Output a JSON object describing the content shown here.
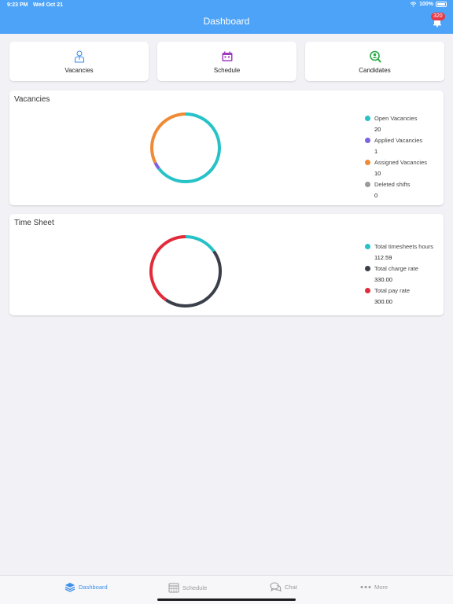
{
  "status_bar": {
    "time": "9:23 PM",
    "date": "Wed Oct 21",
    "battery": "100%"
  },
  "header": {
    "title": "Dashboard",
    "notification_count": "320"
  },
  "tiles": [
    {
      "label": "Vacancies",
      "icon": "person-icon",
      "color": "#3d8fe8"
    },
    {
      "label": "Schedule",
      "icon": "calendar-icon",
      "color": "#9c3dbf"
    },
    {
      "label": "Candidates",
      "icon": "search-person-icon",
      "color": "#27a844"
    }
  ],
  "vacancies_card": {
    "title": "Vacancies",
    "legend": [
      {
        "label": "Open Vacancies",
        "value": "20",
        "color": "#26c2c7"
      },
      {
        "label": "Applied Vacancies",
        "value": "1",
        "color": "#7d63e0"
      },
      {
        "label": "Assigned Vacancies",
        "value": "10",
        "color": "#ef8a35"
      },
      {
        "label": "Deleted shifts",
        "value": "0",
        "color": "#9a9a9a"
      }
    ]
  },
  "timesheet_card": {
    "title": "Time Sheet",
    "legend": [
      {
        "label": "Total timesheets hours",
        "value": "112.59",
        "color": "#26c2c7"
      },
      {
        "label": "Total charge rate",
        "value": "330.00",
        "color": "#3a3f4a"
      },
      {
        "label": "Total pay rate",
        "value": "300.00",
        "color": "#e22b3a"
      }
    ]
  },
  "chart_data": [
    {
      "type": "pie",
      "title": "Vacancies",
      "categories": [
        "Open Vacancies",
        "Applied Vacancies",
        "Assigned Vacancies",
        "Deleted shifts"
      ],
      "values": [
        20,
        1,
        10,
        0
      ],
      "colors": [
        "#26c2c7",
        "#7d63e0",
        "#ef8a35",
        "#9a9a9a"
      ],
      "legend": "right"
    },
    {
      "type": "pie",
      "title": "Time Sheet",
      "categories": [
        "Total timesheets hours",
        "Total charge rate",
        "Total pay rate"
      ],
      "values": [
        112.59,
        330.0,
        300.0
      ],
      "colors": [
        "#26c2c7",
        "#3a3f4a",
        "#e22b3a"
      ],
      "legend": "right"
    }
  ],
  "tabbar": {
    "tabs": [
      {
        "label": "Dashboard",
        "icon": "layers-icon",
        "active": true
      },
      {
        "label": "Schedule",
        "icon": "calendar-icon",
        "active": false
      },
      {
        "label": "Chat",
        "icon": "chat-bubbles-icon",
        "active": false
      },
      {
        "label": "More",
        "icon": "ellipsis-icon",
        "active": false
      }
    ]
  }
}
